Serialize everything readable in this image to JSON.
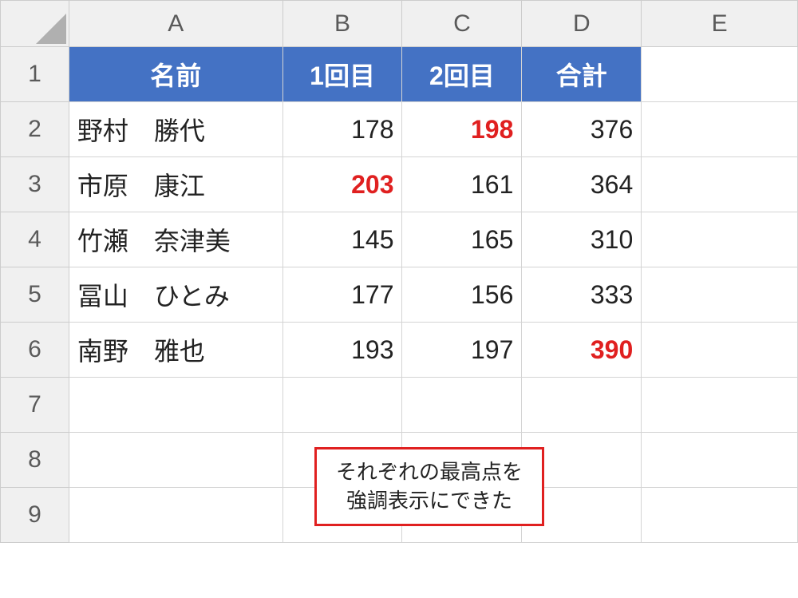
{
  "columns": [
    "A",
    "B",
    "C",
    "D",
    "E"
  ],
  "rowLabels": [
    "1",
    "2",
    "3",
    "4",
    "5",
    "6",
    "7",
    "8",
    "9"
  ],
  "headers": {
    "name": "名前",
    "round1": "1回目",
    "round2": "2回目",
    "total": "合計"
  },
  "rows": [
    {
      "name": "野村　勝代",
      "r1": "178",
      "r2": "198",
      "total": "376",
      "hl": "r2"
    },
    {
      "name": "市原　康江",
      "r1": "203",
      "r2": "161",
      "total": "364",
      "hl": "r1"
    },
    {
      "name": "竹瀬　奈津美",
      "r1": "145",
      "r2": "165",
      "total": "310",
      "hl": ""
    },
    {
      "name": "冨山　ひとみ",
      "r1": "177",
      "r2": "156",
      "total": "333",
      "hl": ""
    },
    {
      "name": "南野　雅也",
      "r1": "193",
      "r2": "197",
      "total": "390",
      "hl": "total"
    }
  ],
  "callout": {
    "line1": "それぞれの最高点を",
    "line2": "強調表示にできた"
  },
  "chart_data": {
    "type": "table",
    "title": "",
    "columns": [
      "名前",
      "1回目",
      "2回目",
      "合計"
    ],
    "data": [
      [
        "野村　勝代",
        178,
        198,
        376
      ],
      [
        "市原　康江",
        203,
        161,
        364
      ],
      [
        "竹瀬　奈津美",
        145,
        165,
        310
      ],
      [
        "冨山　ひとみ",
        177,
        156,
        333
      ],
      [
        "南野　雅也",
        193,
        197,
        390
      ]
    ],
    "highlighted_max": {
      "1回目": 203,
      "2回目": 198,
      "合計": 390
    }
  }
}
